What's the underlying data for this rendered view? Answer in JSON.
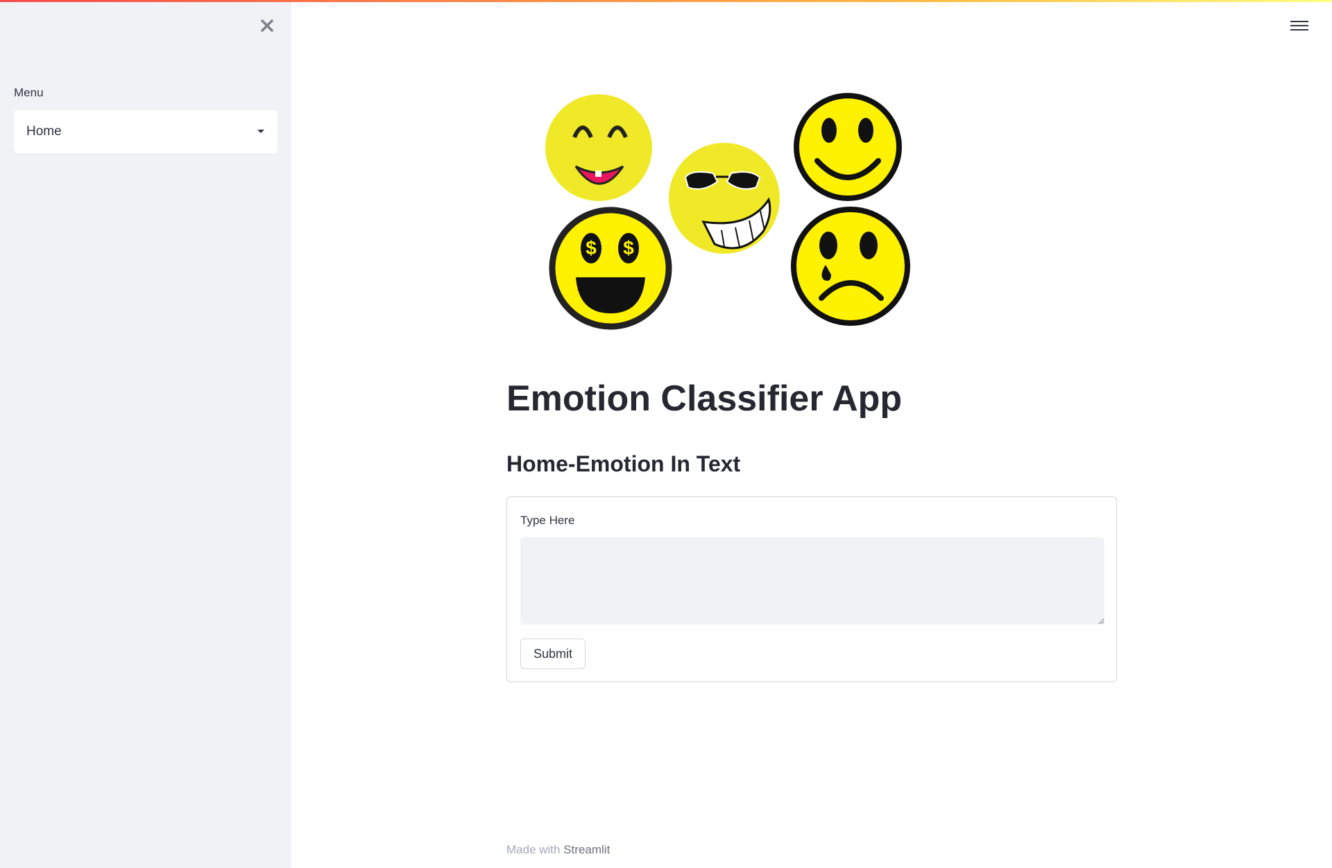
{
  "sidebar": {
    "close_icon": "close-icon",
    "menu_label": "Menu",
    "select_value": "Home",
    "select_icon": "caret-down-icon"
  },
  "header": {
    "menu_icon": "hamburger-icon"
  },
  "main": {
    "hero_image": "emoji-faces-illustration",
    "title": "Emotion Classifier App",
    "subtitle": "Home-Emotion In Text",
    "form": {
      "field_label": "Type Here",
      "field_value": "",
      "submit_label": "Submit"
    }
  },
  "footer": {
    "made_with": "Made with",
    "link": "Streamlit"
  },
  "colors": {
    "sidebar_bg": "#f0f2f6",
    "text": "#31333f",
    "heading": "#262730",
    "emoji_yellow": "#fff200",
    "emoji_light_yellow": "#f0e928"
  }
}
